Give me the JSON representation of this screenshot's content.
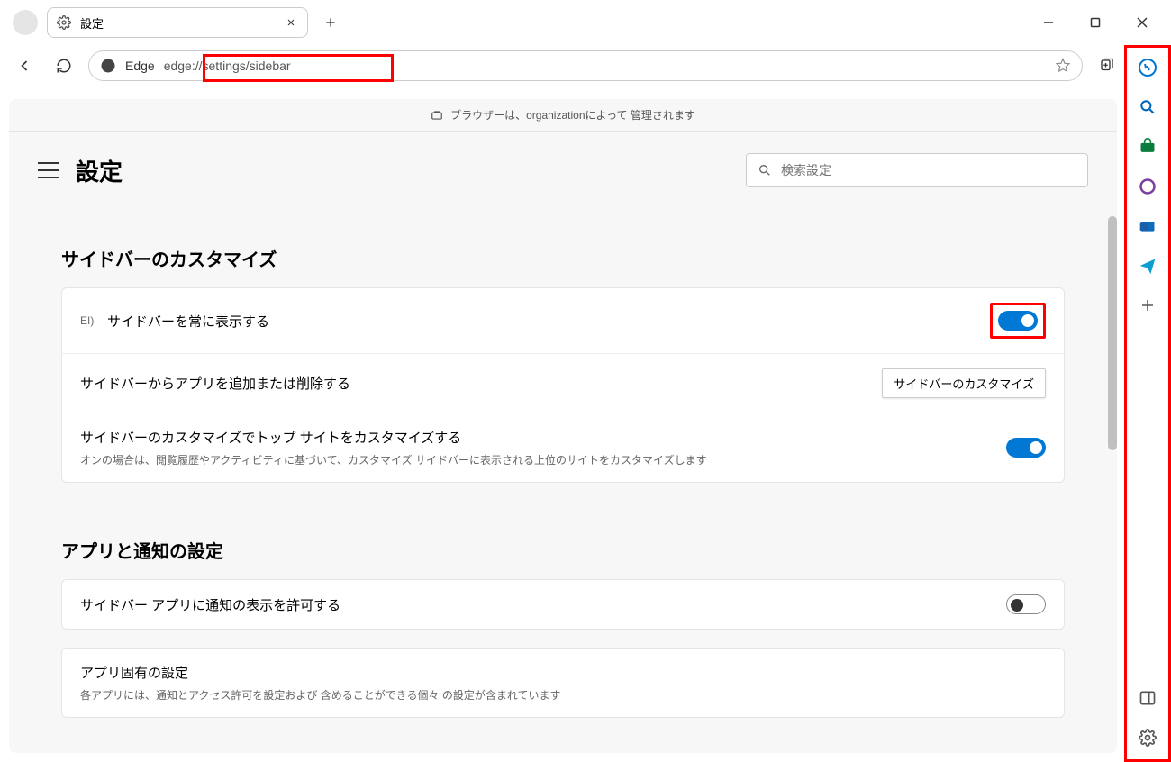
{
  "window": {
    "tab_title": "設定",
    "new_tab_tooltip": "新しいタブ"
  },
  "toolbar": {
    "edge_label": "Edge",
    "url": "edge://settings/sidebar"
  },
  "managed_bar": "ブラウザーは、organizationによって 管理されます",
  "settings": {
    "title": "設定",
    "search_placeholder": "検索設定"
  },
  "section1": {
    "title": "サイドバーのカスタマイズ",
    "row1_leading": "EI)",
    "row1_label": "サイドバーを常に表示する",
    "row2_label": "サイドバーからアプリを追加または削除する",
    "row2_button": "サイドバーのカスタマイズ",
    "row3_label": "サイドバーのカスタマイズでトップ サイトをカスタマイズする",
    "row3_desc": "オンの場合は、閲覧履歴やアクティビティに基づいて、カスタマイズ サイドバーに表示される上位のサイトをカスタマイズします"
  },
  "section2": {
    "title": "アプリと通知の設定",
    "row1_label": "サイドバー アプリに通知の表示を許可する",
    "row2_label": "アプリ固有の設定",
    "row2_desc": "各アプリには、通知とアクセス許可を設定および 含めることができる個々 の設定が含まれています"
  },
  "sidebar_icons": [
    "bing-icon",
    "search-icon",
    "shopping-icon",
    "office-icon",
    "outlook-icon",
    "send-icon",
    "plus-icon"
  ],
  "sidebar_bottom_icons": [
    "panel-icon",
    "settings-icon"
  ]
}
